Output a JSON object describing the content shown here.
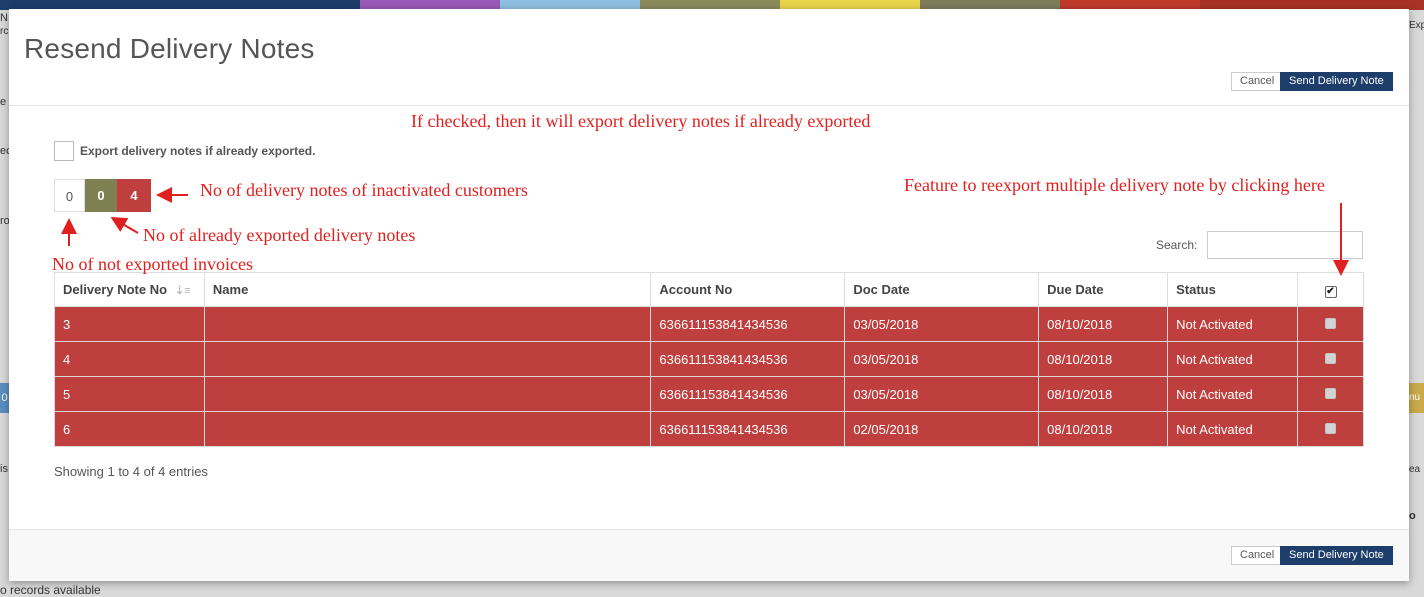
{
  "colors": {
    "strip": [
      "#1d3d6b",
      "#1d3d6b",
      "#9b59b6",
      "#8fbfe0",
      "#8b8b5c",
      "#e9d44a",
      "#7d7d5a",
      "#c0392b",
      "#a93226"
    ],
    "accent_red": "#bf3f3f",
    "olive": "#7d8151",
    "annotation": "#e0201f"
  },
  "background": {
    "left_snippets": [
      "N",
      "rc",
      "e",
      "ec",
      "ro",
      "0",
      "is",
      "o records available"
    ],
    "right_snippets": [
      "Exp",
      "Exp",
      "ea",
      "o",
      "nu"
    ]
  },
  "modal": {
    "title": "Resend Delivery Notes",
    "cancel_label": "Cancel",
    "send_label": "Send Delivery Note",
    "export_checkbox_label": "Export delivery notes if already exported.",
    "counts": {
      "not_exported": "0",
      "already_exported": "0",
      "inactivated": "4"
    },
    "search_label": "Search:",
    "search_value": "",
    "showing": "Showing 1 to 4 of 4 entries"
  },
  "annotations": {
    "checked": "If checked, then it will export delivery notes if already exported",
    "inactivated": "No of delivery notes of inactivated customers",
    "already_exported": "No of already exported delivery notes",
    "not_exported": "No of not exported invoices",
    "reexport": "Feature to reexport multiple delivery note by clicking here"
  },
  "table": {
    "headers": [
      "Delivery Note No",
      "Name",
      "Account No",
      "Doc Date",
      "Due Date",
      "Status"
    ],
    "rows": [
      {
        "no": "3",
        "name": "",
        "account": "636611153841434536",
        "doc_date": "03/05/2018",
        "due_date": "08/10/2018",
        "status": "Not Activated"
      },
      {
        "no": "4",
        "name": "",
        "account": "636611153841434536",
        "doc_date": "03/05/2018",
        "due_date": "08/10/2018",
        "status": "Not Activated"
      },
      {
        "no": "5",
        "name": "",
        "account": "636611153841434536",
        "doc_date": "03/05/2018",
        "due_date": "08/10/2018",
        "status": "Not Activated"
      },
      {
        "no": "6",
        "name": "",
        "account": "636611153841434536",
        "doc_date": "02/05/2018",
        "due_date": "08/10/2018",
        "status": "Not Activated"
      }
    ]
  }
}
